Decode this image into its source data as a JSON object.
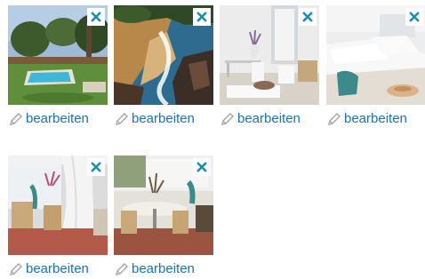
{
  "tiles": [
    {
      "scene": "garden-pool",
      "edit_label": "bearbeiten",
      "remove_icon": "close-icon"
    },
    {
      "scene": "rocky-beach",
      "edit_label": "bearbeiten",
      "remove_icon": "close-icon"
    },
    {
      "scene": "white-living-room",
      "edit_label": "bearbeiten",
      "remove_icon": "close-icon"
    },
    {
      "scene": "white-bedroom",
      "edit_label": "bearbeiten",
      "remove_icon": "close-icon"
    },
    {
      "scene": "curtained-room",
      "edit_label": "bearbeiten",
      "remove_icon": "close-icon"
    },
    {
      "scene": "dining-terrace",
      "edit_label": "bearbeiten",
      "remove_icon": "close-icon"
    }
  ],
  "colors": {
    "link": "#1a73b8",
    "remove_icon": "#1e8fb0",
    "pencil": "#a6a6a6"
  }
}
